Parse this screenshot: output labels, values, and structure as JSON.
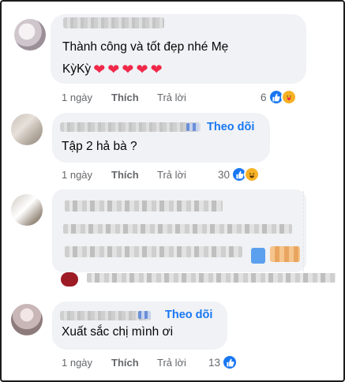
{
  "comments": [
    {
      "text_line1": "Thành công và tốt đẹp nhé Mẹ",
      "text_line2": "KỳKỳ",
      "hearts": [
        "❤",
        "❤",
        "❤",
        "❤",
        "❤"
      ],
      "time": "1 ngày",
      "like_label": "Thích",
      "reply_label": "Trả lời",
      "reaction_count": "6",
      "reactions": [
        "like-icon",
        "care-icon"
      ]
    },
    {
      "follow_label": "Theo dõi",
      "text": "Tập 2 hả bà ?",
      "time": "1 ngày",
      "like_label": "Thích",
      "reply_label": "Trả lời",
      "reaction_count": "30",
      "reactions": [
        "like-icon",
        "haha-icon"
      ]
    },
    {
      "time": "",
      "like_label": "",
      "reply_label": ""
    },
    {
      "follow_label": "Theo dõi",
      "text": "Xuất sắc chị mình ơi",
      "time": "1 ngày",
      "like_label": "Thích",
      "reply_label": "Trả lời",
      "reaction_count": "13",
      "reactions": [
        "like-icon"
      ]
    }
  ],
  "colors": {
    "bubble": "#f0f2f5",
    "link": "#1877f2",
    "meta": "#65676b",
    "heart": "#f02849"
  }
}
